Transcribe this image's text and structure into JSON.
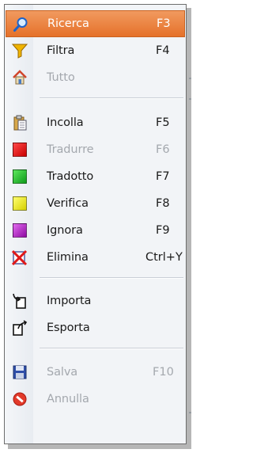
{
  "menu": {
    "items": [
      {
        "id": "ricerca",
        "label": "Ricerca",
        "shortcut": "F3",
        "disabled": false,
        "highlighted": true,
        "icon": "magnifier-icon"
      },
      {
        "id": "filtra",
        "label": "Filtra",
        "shortcut": "F4",
        "disabled": false,
        "highlighted": false,
        "icon": "funnel-icon"
      },
      {
        "id": "tutto",
        "label": "Tutto",
        "shortcut": "",
        "disabled": true,
        "highlighted": false,
        "icon": "home-icon"
      },
      {
        "id": "incolla",
        "label": "Incolla",
        "shortcut": "F5",
        "disabled": false,
        "highlighted": false,
        "icon": "clipboard-icon"
      },
      {
        "id": "tradurre",
        "label": "Tradurre",
        "shortcut": "F6",
        "disabled": true,
        "highlighted": false,
        "icon": "red-square-icon"
      },
      {
        "id": "tradotto",
        "label": "Tradotto",
        "shortcut": "F7",
        "disabled": false,
        "highlighted": false,
        "icon": "green-square-icon"
      },
      {
        "id": "verifica",
        "label": "Verifica",
        "shortcut": "F8",
        "disabled": false,
        "highlighted": false,
        "icon": "yellow-square-icon"
      },
      {
        "id": "ignora",
        "label": "Ignora",
        "shortcut": "F9",
        "disabled": false,
        "highlighted": false,
        "icon": "purple-square-icon"
      },
      {
        "id": "elimina",
        "label": "Elimina",
        "shortcut": "Ctrl+Y",
        "disabled": false,
        "highlighted": false,
        "icon": "delete-x-icon"
      },
      {
        "id": "importa",
        "label": "Importa",
        "shortcut": "",
        "disabled": false,
        "highlighted": false,
        "icon": "import-icon"
      },
      {
        "id": "esporta",
        "label": "Esporta",
        "shortcut": "",
        "disabled": false,
        "highlighted": false,
        "icon": "export-icon"
      },
      {
        "id": "salva",
        "label": "Salva",
        "shortcut": "F10",
        "disabled": true,
        "highlighted": false,
        "icon": "floppy-disk-icon"
      },
      {
        "id": "annulla",
        "label": "Annulla",
        "shortcut": "",
        "disabled": true,
        "highlighted": false,
        "icon": "cancel-icon"
      }
    ],
    "colors": {
      "highlight": "#e97b34",
      "red": "#e01010",
      "green": "#1fbf2a",
      "yellow": "#eded1a",
      "purple": "#b318c2",
      "disabled_text": "#a4a8ae"
    }
  }
}
